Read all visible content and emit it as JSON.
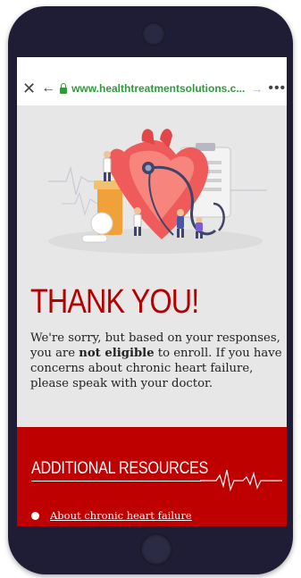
{
  "browser": {
    "url": "www.healthtreatmentsolutions.c...",
    "icons": [
      "close-icon",
      "back-arrow-icon",
      "lock-icon",
      "forward-arrow-icon",
      "more-icon"
    ]
  },
  "page": {
    "title": "THANK YOU!",
    "message_part1": "We're sorry, but based on your responses, you are ",
    "message_bold": "not eligible",
    "message_part2": " to enroll. If you have concerns about chronic heart failure, please speak with your doctor."
  },
  "resources": {
    "heading": "ADDITIONAL RESOURCES",
    "links": [
      {
        "label": "About chronic heart failure"
      }
    ]
  },
  "colors": {
    "brand_red": "#bf0000",
    "title_red": "#b30000",
    "url_green": "#2e9a3a",
    "phone_frame": "#1f1d35"
  }
}
